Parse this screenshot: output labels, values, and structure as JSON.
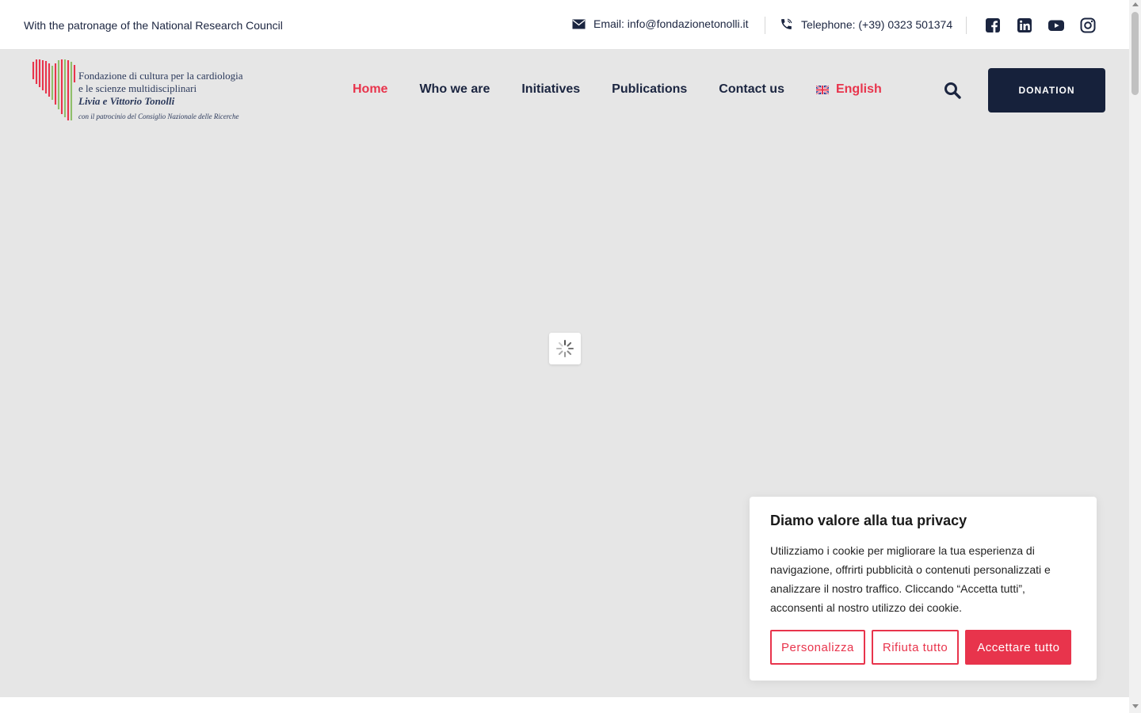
{
  "topbar": {
    "patronage": "With the patronage of the National Research Council",
    "email": "Email: info@fondazionetonolli.it",
    "phone": "Telephone: (+39) 0323 501374",
    "email_icon": "envelope-icon",
    "phone_icon": "phone-icon",
    "socials": [
      "facebook-icon",
      "linkedin-icon",
      "youtube-icon",
      "instagram-icon"
    ]
  },
  "logo": {
    "line1": "Fondazione di cultura per la cardiologia",
    "line2": "e le scienze multidisciplinari",
    "line3": "Livia e Vittorio Tonolli",
    "line4": "con il patrocinio del Consiglio Nazionale delle Ricerche"
  },
  "nav": {
    "home": "Home",
    "who": "Who we are",
    "initiatives": "Initiatives",
    "publications": "Publications",
    "contact": "Contact us",
    "language": "English",
    "donation": "DONATION"
  },
  "cookie": {
    "title": "Diamo valore alla tua privacy",
    "text": "Utilizziamo i cookie per migliorare la tua esperienza di navigazione, offrirti pubblicità o contenuti personalizzati e analizzare il nostro traffico. Cliccando “Accetta tutti”, acconsenti al nostro utilizzo dei cookie.",
    "customize": "Personalizza",
    "reject": "Rifiuta tutto",
    "accept": "Accettare tutto"
  },
  "colors": {
    "accent": "#e8344c",
    "navy": "#16213b",
    "text": "#1b2540",
    "background": "#e6e6e6"
  }
}
